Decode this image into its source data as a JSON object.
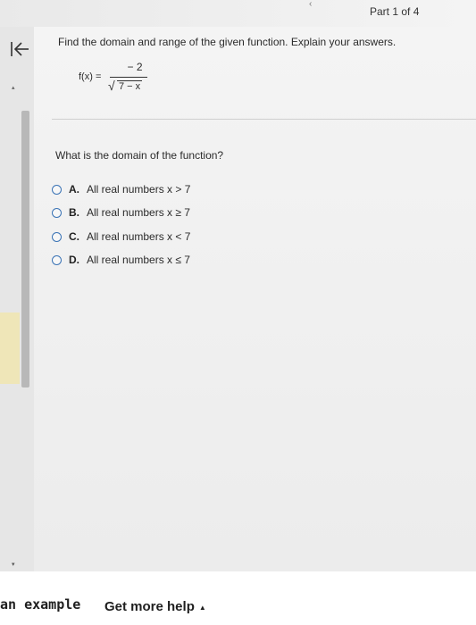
{
  "header": {
    "part_indicator": "Part 1 of 4",
    "chevron": "‹"
  },
  "sidebar": {
    "collapse_icon": "arrow-left-to-bar-icon",
    "up_arrow": "▴",
    "down_arrow": "▾"
  },
  "problem": {
    "prompt": "Find the domain and range of the given function. Explain your answers.",
    "function_lhs": "f(x) =",
    "numerator": "− 2",
    "sqrt_sign": "√",
    "radicand": "7 − x"
  },
  "question": {
    "text": "What is the domain of the function?",
    "options": [
      {
        "letter": "A.",
        "text": "All real numbers x > 7"
      },
      {
        "letter": "B.",
        "text": "All real numbers x ≥ 7"
      },
      {
        "letter": "C.",
        "text": "All real numbers x < 7"
      },
      {
        "letter": "D.",
        "text": "All real numbers x ≤ 7"
      }
    ]
  },
  "footer": {
    "example_label": "an example",
    "help_label": "Get more help",
    "help_caret": "▲"
  },
  "colors": {
    "radio_border": "#3a73b5",
    "background": "#f2f2f2"
  }
}
